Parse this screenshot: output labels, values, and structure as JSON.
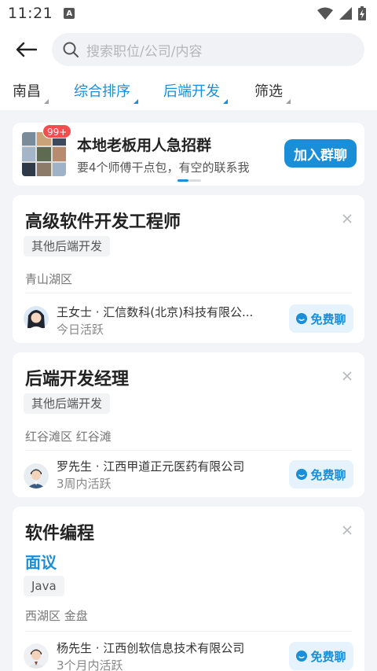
{
  "status": {
    "time": "11:21",
    "notif_letter": "A"
  },
  "search": {
    "placeholder": "搜索职位/公司/内容"
  },
  "filters": [
    {
      "label": "南昌",
      "active": false
    },
    {
      "label": "综合排序",
      "active": true
    },
    {
      "label": "后端开发",
      "active": true
    },
    {
      "label": "筛选",
      "active": false
    }
  ],
  "banner": {
    "badge": "99+",
    "title": "本地老板用人急招群",
    "subtitle": "要4个师傅干点包，有空的联系我",
    "join_label": "加入群聊"
  },
  "jobs": [
    {
      "title": "高级软件开发工程师",
      "tag": "其他后端开发",
      "location": "青山湖区",
      "recruiter": "王女士 · 汇信数科(北京)科技有限公...",
      "active": "今日活跃",
      "chat_label": "免费聊"
    },
    {
      "title": "后端开发经理",
      "tag": "其他后端开发",
      "location": "红谷滩区 红谷滩",
      "recruiter": "罗先生 · 江西甲道正元医药有限公司",
      "active": "3周内活跃",
      "chat_label": "免费聊"
    },
    {
      "title": "软件编程",
      "salary": "面议",
      "tag": "Java",
      "location": "西湖区 金盘",
      "recruiter": "杨先生 · 江西创软信息技术有限公司",
      "active": "3个月内活跃",
      "chat_label": "免费聊"
    }
  ],
  "colors": {
    "accent": "#1a8fd8",
    "badge": "#f24e4e",
    "background": "#f2f4f7"
  }
}
